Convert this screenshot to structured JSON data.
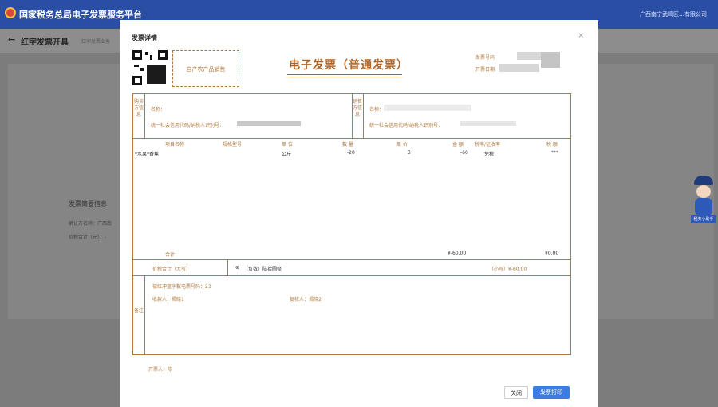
{
  "app": {
    "title": "国家税务总局电子发票服务平台",
    "company": "广西南宁武鸣区…有限公司"
  },
  "page": {
    "back_icon": "←",
    "title": "红字发票开具",
    "breadcrumb": "红字发票业务",
    "section_title": "发票简要信息",
    "line1": "确认方名称：广西南",
    "line2": "价税合计（元）：-"
  },
  "mascot_tag": "税务小助手",
  "modal": {
    "title": "发票详情",
    "close_icon": "×",
    "stamp": "自产农产品销售",
    "invoice_title": "电子发票（普通发票）",
    "invoice_no_label": "发票号码",
    "invoice_date_label": "开票日期",
    "buyer_label": "购买方信息",
    "seller_label": "销售方信息",
    "buyer_name_label": "名称：",
    "buyer_tax_label": "统一社会信用代码/纳税人识别号：",
    "seller_name_label": "名称：",
    "seller_tax_label": "统一社会信用代码/纳税人识别号：",
    "items": {
      "headers": [
        "项目名称",
        "规格型号",
        "单 位",
        "数 量",
        "单 价",
        "金 额",
        "税率/征收率",
        "税 额"
      ],
      "rows": [
        [
          "*水果*香蕉",
          "",
          "公斤",
          "-20",
          "3",
          "-60",
          "免税",
          "***"
        ]
      ],
      "total_label": "合计",
      "total_amount": "¥-60.00",
      "total_tax": "¥0.00"
    },
    "grand_total_label": "价税合计（大写）",
    "grand_total_symbol": "⊗",
    "grand_total_words": "（负数）陆拾圆整",
    "grand_total_small": "（小写）¥-60.00",
    "remarks_label": "备注",
    "remark_line1": "被红冲蓝字数电票号码：23",
    "remark_payee": "收款人：揭晓1",
    "remark_reviewer": "复核人：揭晓2",
    "issuer_label": "开票人：",
    "issuer_value": "陈",
    "close_button": "关闭",
    "print_button": "发票打印"
  }
}
